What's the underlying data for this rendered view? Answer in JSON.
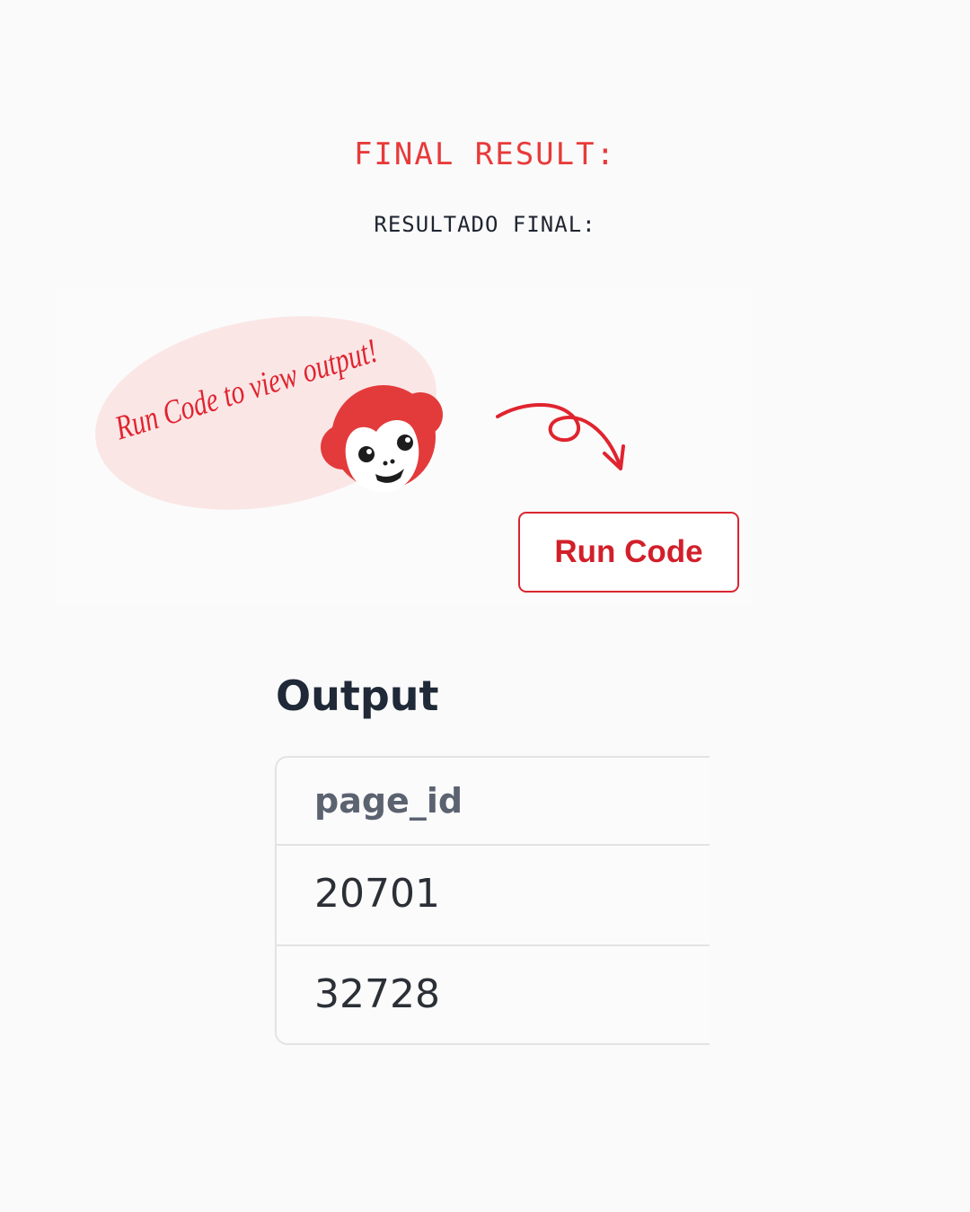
{
  "heading": {
    "title": "FINAL RESULT:",
    "subtitle": "RESULTADO FINAL:"
  },
  "run_panel": {
    "prompt": "Run Code to view output!",
    "button_label": "Run Code",
    "mascot": "monkey-icon",
    "arrow": "curly-arrow-icon"
  },
  "output": {
    "title": "Output",
    "columns": [
      "page_id"
    ],
    "rows": [
      [
        "20701"
      ],
      [
        "32728"
      ]
    ]
  },
  "colors": {
    "accent": "#e83a3a",
    "button_text": "#d21f2a",
    "bubble": "#fbe6e6",
    "text_dark": "#1f2937"
  }
}
